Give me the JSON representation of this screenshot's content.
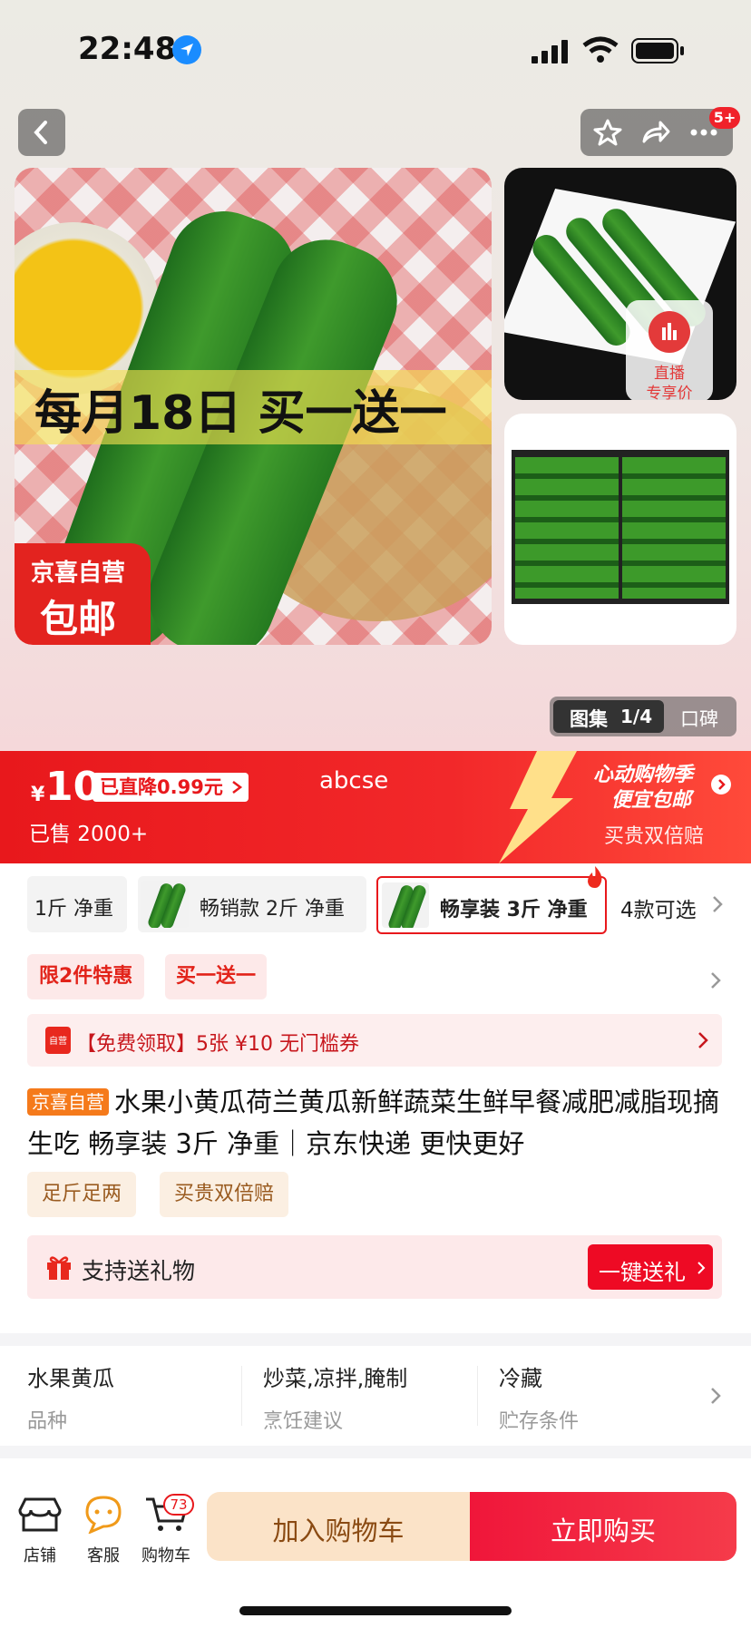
{
  "status": {
    "time": "22:48"
  },
  "nav": {
    "badge": "5+"
  },
  "hero": {
    "banner_text": "每月18日 买一送一",
    "corner_line1": "京喜自营",
    "corner_line2": "包邮",
    "live_label1": "直播",
    "live_label2": "专享价",
    "gallery_label": "图集",
    "gallery_count": "1/4",
    "reviews_label": "口碑"
  },
  "price": {
    "currency": "¥",
    "amount": "10",
    "drop": "已直降0.99元",
    "sold": "已售 2000+",
    "watermark": "abcse",
    "promo_title1": "心动购物季",
    "promo_title2": "便宜包邮",
    "promo_sub": "买贵双倍赔"
  },
  "variants": {
    "items": [
      {
        "label": "1斤 净重"
      },
      {
        "label": "畅销款 2斤 净重"
      },
      {
        "label": "畅享装 3斤 净重"
      }
    ],
    "more": "4款可选"
  },
  "promos": {
    "tag1": "限2件特惠",
    "tag2": "买一送一"
  },
  "coupon": {
    "icon_text": "自营",
    "text": "【免费领取】5张 ¥10 无门槛券"
  },
  "product": {
    "badge": "京喜自营",
    "title": "水果小黄瓜荷兰黄瓜新鲜蔬菜生鲜早餐减肥减脂现摘生吃 畅享装 3斤 净重｜京东快递 更快更好",
    "tag1": "足斤足两",
    "tag2": "买贵双倍赔"
  },
  "gift": {
    "label": "支持送礼物",
    "button": "一键送礼"
  },
  "specs": [
    {
      "value": "水果黄瓜",
      "key": "品种"
    },
    {
      "value": "炒菜,凉拌,腌制",
      "key": "烹饪建议"
    },
    {
      "value": "冷藏",
      "key": "贮存条件"
    }
  ],
  "bottom": {
    "store": "店铺",
    "service": "客服",
    "cart": "购物车",
    "cart_count": "73",
    "add_cart": "加入购物车",
    "buy_now": "立即购买"
  },
  "colors": {
    "brand_red": "#e8181c",
    "orange_badge": "#f57a1b",
    "cream_button": "#fbe3c8"
  }
}
